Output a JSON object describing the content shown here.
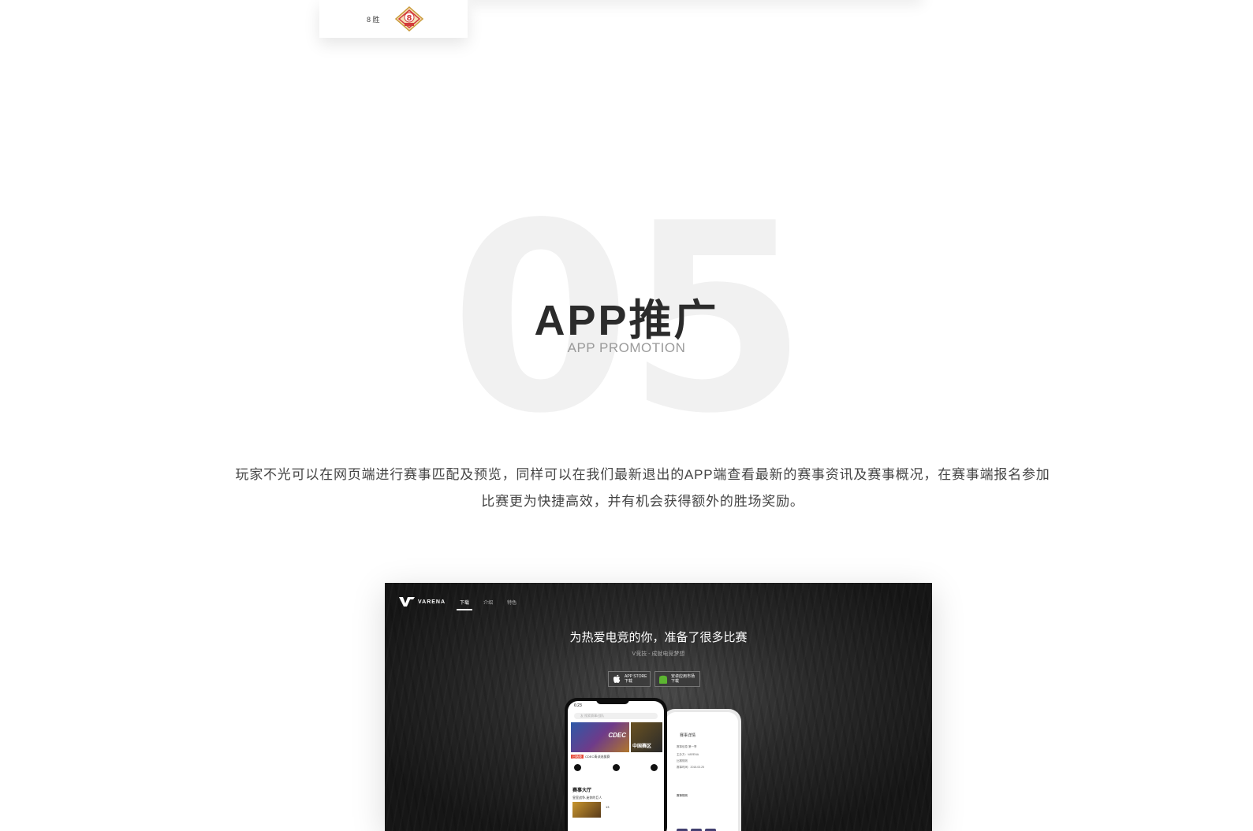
{
  "top_card": {
    "win_text": "8 胜",
    "badge_number": "8"
  },
  "section": {
    "number": "05",
    "title": "APP推广",
    "subtitle": "APP PROMOTION",
    "description_line1": "玩家不光可以在网页端进行赛事匹配及预览，同样可以在我们最新退出的APP端查看最新的赛事资讯及赛事概况，在赛事端报名参加",
    "description_line2": "比赛更为快捷高效，并有机会获得额外的胜场奖励。"
  },
  "app_screenshot": {
    "brand": "VARENA",
    "nav": [
      "下载",
      "介绍",
      "特色"
    ],
    "hero_title": "为热爱电竞的你，准备了很多比赛",
    "hero_subtitle": "V竞技 - 成就电竞梦想",
    "btn_appstore_line1": "APP STORE",
    "btn_appstore_line2": "下载",
    "btn_android_line1": "安卓应用市场",
    "btn_android_line2": "下载",
    "phone_front": {
      "time": "6:23",
      "search_placeholder": "友 搜索赛事/战队",
      "banner_main": "CDEC",
      "banner_side": "中国赛区",
      "tagline_tag": "已结束",
      "tagline": "CDEC青训选拔赛",
      "section_heading": "赛事大厅",
      "list_item": "皇室战争-迷你的巨人",
      "list_value": "13"
    },
    "phone_back": {
      "title": "赛事详情",
      "line1": "赛事信息 第一季",
      "line2": "主办方：VARENA",
      "line3": "比赛规则",
      "line4": "赛事时间：2018.03.25",
      "tab": "赛事规则"
    },
    "colors": {
      "accent_green": "#5cb531",
      "tag_red": "#e74c3c"
    }
  }
}
